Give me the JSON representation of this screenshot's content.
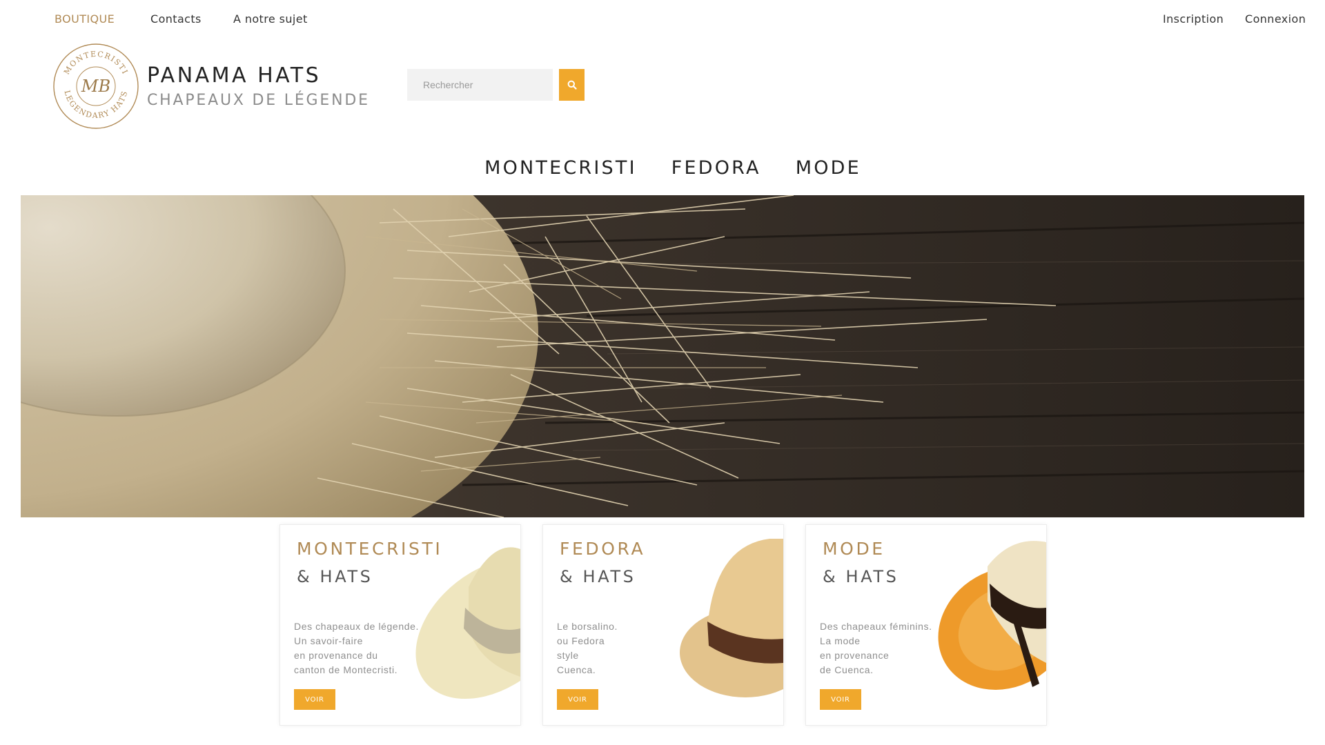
{
  "topnav": {
    "left": [
      "BOUTIQUE",
      "Contacts",
      "A notre sujet"
    ],
    "right": [
      "Inscription",
      "Connexion"
    ]
  },
  "logo": {
    "monogram": "MB",
    "ring_top": "MONTECRISTI",
    "ring_bottom": "LEGENDARY HATS"
  },
  "brand": {
    "title": "PANAMA HATS",
    "subtitle": "CHAPEAUX DE LÉGENDE"
  },
  "search": {
    "placeholder": "Rechercher",
    "button_icon": "search-icon"
  },
  "mainnav": [
    "MONTECRISTI",
    "FEDORA",
    "MODE"
  ],
  "colors": {
    "accent": "#f0a82c",
    "gold": "#b08a55",
    "text": "#222222"
  },
  "cards": [
    {
      "title": "MONTECRISTI",
      "subtitle": "& HATS",
      "lines": [
        "Des chapeaux de légende.",
        "Un savoir-faire",
        "en provenance du",
        "canton de Montecristi."
      ],
      "button": "VOIR"
    },
    {
      "title": "FEDORA",
      "subtitle": "& HATS",
      "lines": [
        "Le borsalino.",
        "ou Fedora",
        "style",
        "Cuenca."
      ],
      "button": "VOIR"
    },
    {
      "title": "MODE",
      "subtitle": "& HATS",
      "lines": [
        "Des chapeaux féminins.",
        "La mode",
        "en provenance",
        "de Cuenca."
      ],
      "button": "VOIR"
    }
  ]
}
